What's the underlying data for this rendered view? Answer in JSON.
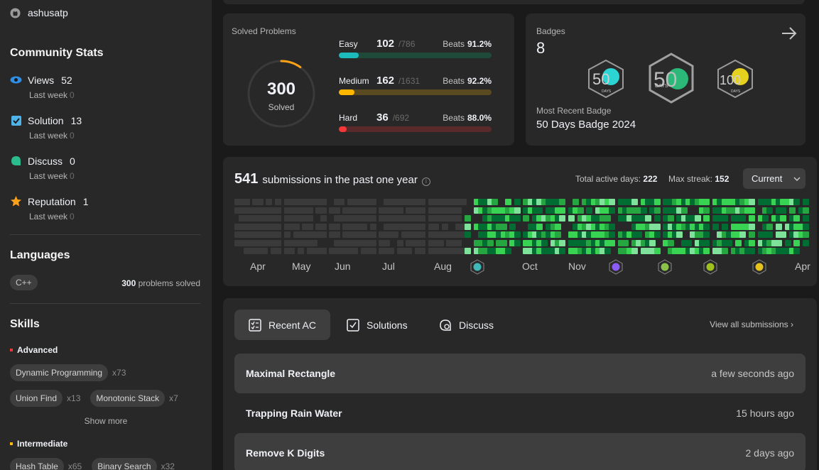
{
  "user": {
    "username": "ashusatp"
  },
  "community_stats": {
    "title": "Community Stats",
    "items": [
      {
        "label": "Views",
        "value": "52",
        "sub_label": "Last week",
        "sub_value": "0"
      },
      {
        "label": "Solution",
        "value": "13",
        "sub_label": "Last week",
        "sub_value": "0"
      },
      {
        "label": "Discuss",
        "value": "0",
        "sub_label": "Last week",
        "sub_value": "0"
      },
      {
        "label": "Reputation",
        "value": "1",
        "sub_label": "Last week",
        "sub_value": "0"
      }
    ]
  },
  "languages": {
    "title": "Languages",
    "items": [
      {
        "name": "C++",
        "count": "300",
        "suffix": "problems solved"
      }
    ]
  },
  "skills": {
    "title": "Skills",
    "advanced": {
      "label": "Advanced",
      "tags": [
        {
          "name": "Dynamic Programming",
          "count": "x73"
        },
        {
          "name": "Union Find",
          "count": "x13"
        },
        {
          "name": "Monotonic Stack",
          "count": "x7"
        }
      ]
    },
    "show_more": "Show more",
    "intermediate": {
      "label": "Intermediate",
      "tags": [
        {
          "name": "Hash Table",
          "count": "x65"
        },
        {
          "name": "Binary Search",
          "count": "x32"
        }
      ]
    }
  },
  "solved": {
    "title": "Solved Problems",
    "total": "300",
    "total_label": "Solved",
    "total_fraction": 0.099,
    "beats_label": "Beats",
    "levels": [
      {
        "name": "Easy",
        "solved": "102",
        "total": "/786",
        "beats": "91.2%",
        "fraction": 0.13,
        "color": "#1cbaba",
        "track": "#1f4a3a"
      },
      {
        "name": "Medium",
        "solved": "162",
        "total": "/1631",
        "beats": "92.2%",
        "fraction": 0.1,
        "color": "#ffb700",
        "track": "#5a4a1f"
      },
      {
        "name": "Hard",
        "solved": "36",
        "total": "/692",
        "beats": "88.0%",
        "fraction": 0.05,
        "color": "#f63737",
        "track": "#5a2a2a"
      }
    ]
  },
  "badges": {
    "title": "Badges",
    "count": "8",
    "recent_label": "Most Recent Badge",
    "recent_name": "50 Days Badge 2024",
    "badge_texts": [
      "50",
      "DAYS",
      "50",
      "DAYS",
      "100",
      "DAYS"
    ]
  },
  "calendar": {
    "count": "541",
    "label": "submissions in the past one year",
    "active_label": "Total active days:",
    "active_value": "222",
    "streak_label": "Max streak:",
    "streak_value": "152",
    "select": "Current",
    "months": [
      "Apr",
      "May",
      "Jun",
      "Jul",
      "Aug",
      "Oct",
      "Nov",
      "Apr"
    ]
  },
  "tabs": [
    {
      "label": "Recent AC"
    },
    {
      "label": "Solutions"
    },
    {
      "label": "Discuss"
    }
  ],
  "view_all": "View all submissions",
  "submissions": [
    {
      "title": "Maximal Rectangle",
      "time": "a few seconds ago"
    },
    {
      "title": "Trapping Rain Water",
      "time": "15 hours ago"
    },
    {
      "title": "Remove K Digits",
      "time": "2 days ago"
    }
  ],
  "colors": {
    "accent_easy": "#1cbaba",
    "accent_medium": "#ffb700",
    "accent_hard": "#f63737",
    "heat_green": "#26a641"
  }
}
